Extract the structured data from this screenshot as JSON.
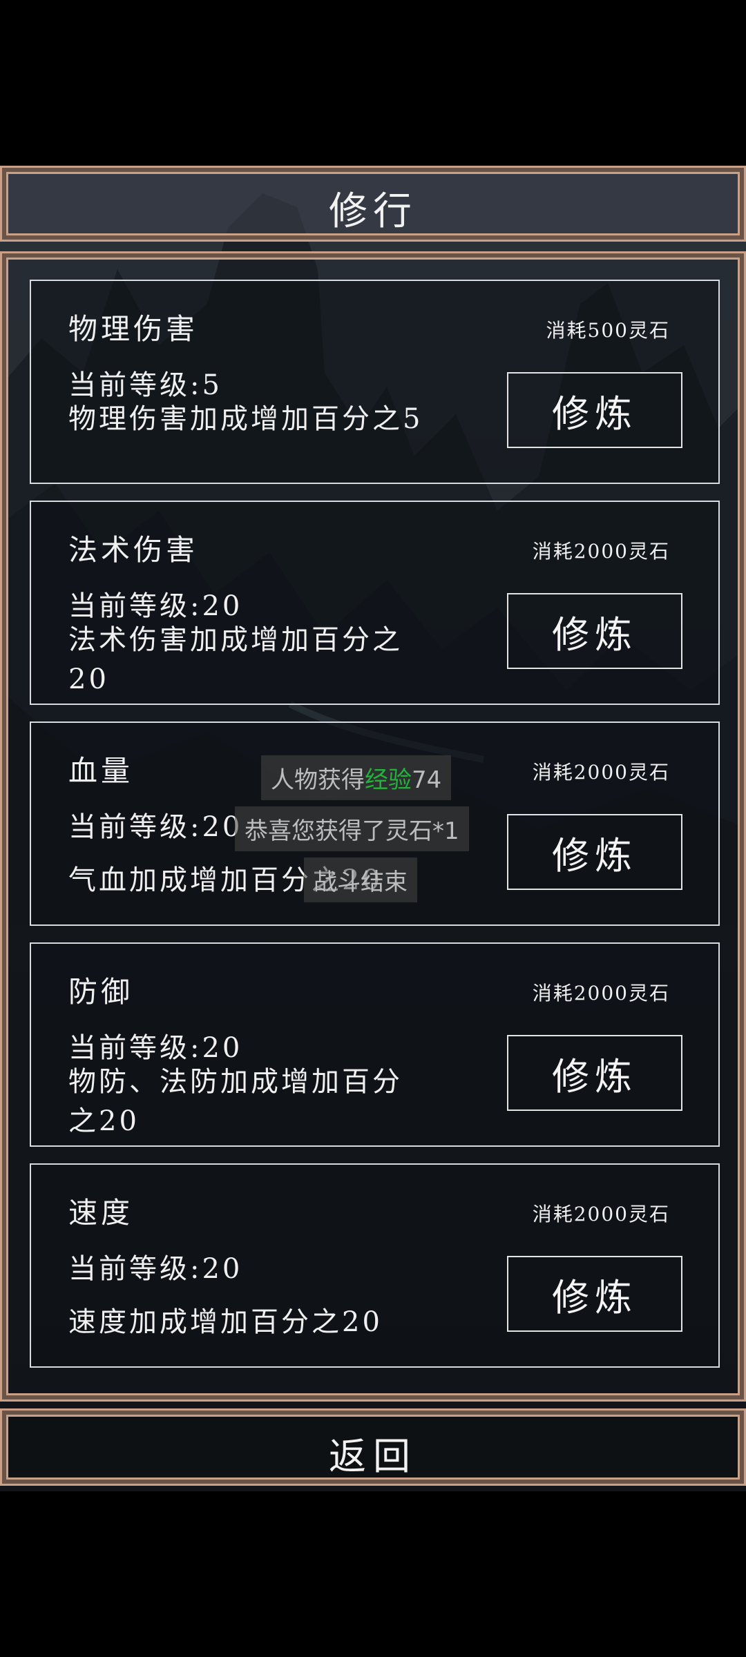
{
  "header": {
    "title": "修行"
  },
  "cards": [
    {
      "title": "物理伤害",
      "cost": "消耗500灵石",
      "level": "当前等级:5",
      "desc": "物理伤害加成增加百分之5",
      "button": "修炼"
    },
    {
      "title": "法术伤害",
      "cost": "消耗2000灵石",
      "level": "当前等级:20",
      "desc": "法术伤害加成增加百分之20",
      "button": "修炼"
    },
    {
      "title": "血量",
      "cost": "消耗2000灵石",
      "level": "当前等级:20",
      "desc": "气血加成增加百分之20",
      "button": "修炼"
    },
    {
      "title": "防御",
      "cost": "消耗2000灵石",
      "level": "当前等级:20",
      "desc": "物防、法防加成增加百分之20",
      "button": "修炼"
    },
    {
      "title": "速度",
      "cost": "消耗2000灵石",
      "level": "当前等级:20",
      "desc": "速度加成增加百分之20",
      "button": "修炼"
    }
  ],
  "toasts": {
    "exp_prefix": "人物获得",
    "exp_highlight": "经验",
    "exp_value": "74",
    "stone": "恭喜您获得了灵石*1",
    "battle_end": "战斗结束"
  },
  "colors": {
    "frame_border": "#c9a088",
    "exp_highlight": "#22b33a"
  },
  "footer": {
    "back_label": "返回"
  }
}
